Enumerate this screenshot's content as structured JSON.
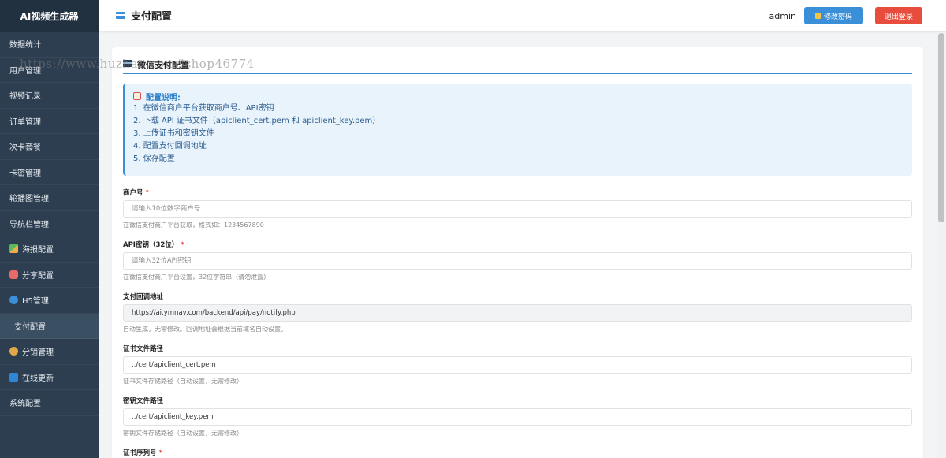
{
  "sidebar": {
    "brand": "AI视频生成器",
    "items": [
      {
        "label": "数据统计",
        "icon": ""
      },
      {
        "label": "用户管理",
        "icon": ""
      },
      {
        "label": "视频记录",
        "icon": ""
      },
      {
        "label": "订单管理",
        "icon": ""
      },
      {
        "label": "次卡套餐",
        "icon": ""
      },
      {
        "label": "卡密管理",
        "icon": ""
      },
      {
        "label": "轮播图管理",
        "icon": ""
      },
      {
        "label": "导航栏管理",
        "icon": ""
      },
      {
        "label": "海报配置",
        "icon": "poster-icon"
      },
      {
        "label": "分享配置",
        "icon": "share-icon"
      },
      {
        "label": "H5管理",
        "icon": "globe-icon"
      },
      {
        "label": "支付配置",
        "icon": "",
        "active": true
      },
      {
        "label": "分销管理",
        "icon": "money-bag-icon"
      },
      {
        "label": "在线更新",
        "icon": "refresh-icon"
      },
      {
        "label": "系统配置",
        "icon": ""
      }
    ]
  },
  "header": {
    "title": "支付配置",
    "admin": "admin",
    "change_password_label": "修改密码",
    "logout_label": "退出登录"
  },
  "panel": {
    "title": "微信支付配置",
    "info": {
      "heading": "配置说明:",
      "lines": [
        "1. 在微信商户平台获取商户号、API密钥",
        "2. 下载 API 证书文件（apiclient_cert.pem 和 apiclient_key.pem）",
        "3. 上传证书和密钥文件",
        "4. 配置支付回调地址",
        "5. 保存配置"
      ]
    },
    "fields": {
      "merchant_id": {
        "label": "商户号",
        "required": "*",
        "value": "",
        "placeholder": "请输入10位数字商户号",
        "hint": "在微信支付商户平台获取，格式如：1234567890"
      },
      "api_key": {
        "label": "API密钥（32位）",
        "required": "*",
        "value": "",
        "placeholder": "请输入32位API密钥",
        "hint": "在微信支付商户平台设置，32位字符串（请勿泄露）"
      },
      "notify_url": {
        "label": "支付回调地址",
        "value": "https://ai.ymnav.com/backend/api/pay/notify.php",
        "hint": "自动生成，无需修改。回调地址会根据当前域名自动设置。"
      },
      "cert_path": {
        "label": "证书文件路径",
        "value": "../cert/apiclient_cert.pem",
        "hint": "证书文件存储路径（自动设置，无需修改）"
      },
      "key_path": {
        "label": "密钥文件路径",
        "value": "../cert/apiclient_key.pem",
        "hint": "密钥文件存储路径（自动设置，无需修改）"
      },
      "serial_no": {
        "label": "证书序列号",
        "required": "*"
      }
    }
  },
  "watermark": "https://www.huzhan.com/ishop46774"
}
